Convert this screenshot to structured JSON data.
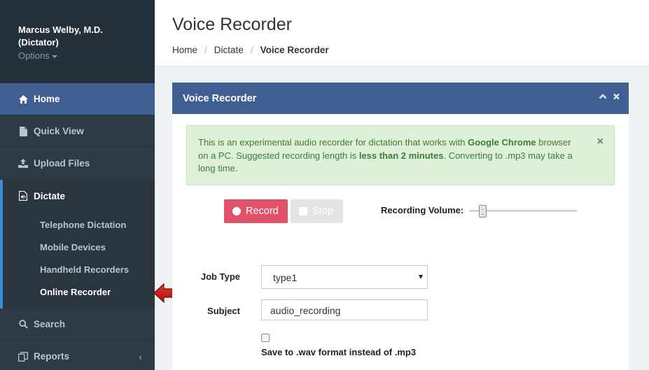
{
  "profile": {
    "name": "Marcus Welby, M.D.",
    "role": "(Dictator)",
    "options": "Options"
  },
  "sidebar": {
    "items": [
      {
        "label": "Home",
        "icon": "home-icon"
      },
      {
        "label": "Quick View",
        "icon": "file-icon"
      },
      {
        "label": "Upload Files",
        "icon": "upload-icon"
      },
      {
        "label": "Dictate",
        "icon": "audio-file-icon"
      },
      {
        "label": "Search",
        "icon": "search-icon"
      },
      {
        "label": "Reports",
        "icon": "copy-icon"
      }
    ],
    "dictate_sub": [
      "Telephone Dictation",
      "Mobile Devices",
      "Handheld Recorders",
      "Online Recorder"
    ]
  },
  "header": {
    "title": "Voice Recorder",
    "breadcrumb": [
      "Home",
      "Dictate",
      "Voice Recorder"
    ]
  },
  "panel": {
    "title": "Voice Recorder",
    "alert": {
      "t1": "This is an experimental audio recorder for dictation that works with ",
      "b1": "Google Chrome",
      "t2": " browser on a PC. Suggested recording length is ",
      "b2": "less than 2 minutes",
      "t3": ". Converting to .mp3 may take a long time."
    },
    "record_label": "Record",
    "stop_label": "Stop",
    "volume_label": "Recording Volume:",
    "volume_level": 0.1,
    "job_type_label": "Job Type",
    "job_type_value": "type1",
    "subject_label": "Subject",
    "subject_value": "audio_recording",
    "wav_label": "Save to .wav format instead of .mp3"
  },
  "colors": {
    "sidebar_bg": "#2e3a44",
    "accent": "#3f5f93",
    "record": "#e0526a",
    "alert_bg": "#dff0d8"
  }
}
